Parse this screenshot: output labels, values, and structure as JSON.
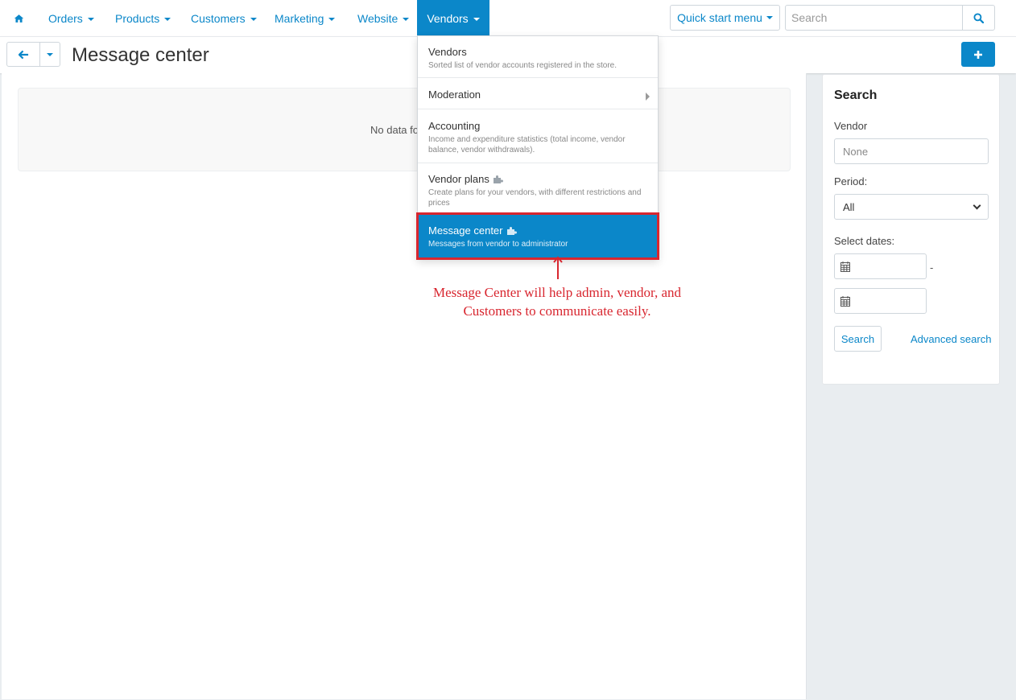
{
  "nav": {
    "home_icon": "home-icon",
    "items": [
      {
        "label": "Orders"
      },
      {
        "label": "Products"
      },
      {
        "label": "Customers"
      },
      {
        "label": "Marketing"
      },
      {
        "label": "Website"
      },
      {
        "label": "Vendors"
      }
    ],
    "quick_start": "Quick start menu",
    "search_placeholder": "Search"
  },
  "header": {
    "title": "Message center"
  },
  "main": {
    "empty_text": "No data fo"
  },
  "vendors_menu": [
    {
      "title": "Vendors",
      "desc": "Sorted list of vendor accounts registered in the store."
    },
    {
      "title": "Moderation",
      "desc": ""
    },
    {
      "title": "Accounting",
      "desc": "Income and expenditure statistics (total income, vendor balance, vendor withdrawals)."
    },
    {
      "title": "Vendor plans",
      "desc": "Create plans for your vendors, with different restrictions and prices"
    },
    {
      "title": "Message center",
      "desc": "Messages from vendor to administrator"
    }
  ],
  "sidebar": {
    "title": "Search",
    "vendor_label": "Vendor",
    "vendor_placeholder": "None",
    "period_label": "Period:",
    "period_value": "All",
    "dates_label": "Select dates:",
    "dash": "-",
    "search_button": "Search",
    "advanced_link": "Advanced search"
  },
  "annotation": {
    "line1": "Message Center will help admin, vendor, and",
    "line2": "Customers to communicate easily."
  },
  "colors": {
    "accent": "#0b87c9",
    "annotation": "#d8262f"
  }
}
